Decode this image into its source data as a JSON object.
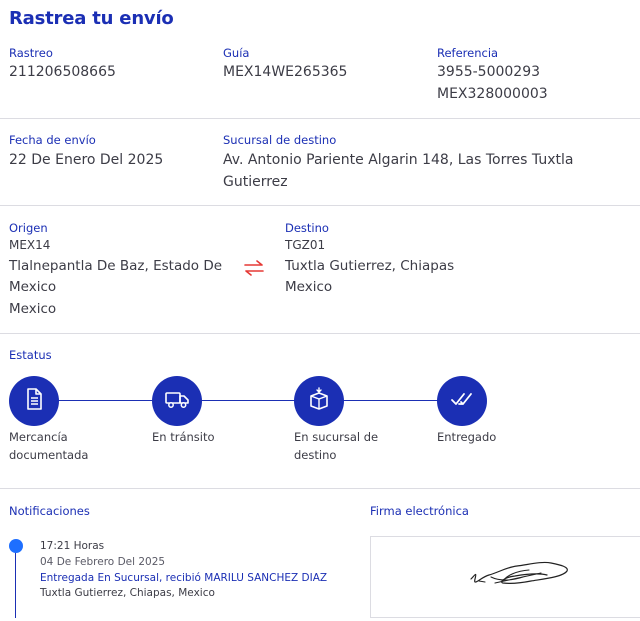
{
  "header": {
    "title": "Rastrea tu envío"
  },
  "info_row1": {
    "rastreo": {
      "label": "Rastreo",
      "value": "211206508665"
    },
    "guia": {
      "label": "Guía",
      "value": "MEX14WE265365"
    },
    "referencia": {
      "label": "Referencia",
      "value1": "3955-5000293",
      "value2": "MEX328000003"
    }
  },
  "info_row2": {
    "fecha": {
      "label": "Fecha de envío",
      "value": "22 De Enero Del 2025"
    },
    "sucursal": {
      "label": "Sucursal de destino",
      "value1": "Av. Antonio Pariente Algarin 148, Las Torres Tuxtla",
      "value2": "Gutierrez"
    }
  },
  "route": {
    "origen": {
      "label": "Origen",
      "code": "MEX14",
      "line1": "Tlalnepantla De Baz, Estado De",
      "line2": "Mexico",
      "line3": "Mexico"
    },
    "swap_icon": "swap-arrows-icon",
    "destino": {
      "label": "Destino",
      "code": "TGZ01",
      "line1": "Tuxtla Gutierrez, Chiapas",
      "line2": "Mexico"
    }
  },
  "status": {
    "label": "Estatus",
    "steps": [
      {
        "icon": "document-icon",
        "line1": "Mercancía",
        "line2": "documentada"
      },
      {
        "icon": "truck-icon",
        "line1": "En tránsito",
        "line2": ""
      },
      {
        "icon": "package-icon",
        "line1": "En sucursal de",
        "line2": "destino"
      },
      {
        "icon": "double-check-icon",
        "line1": "Entregado",
        "line2": ""
      }
    ]
  },
  "notifications": {
    "label": "Notificaciones",
    "items": [
      {
        "time": "17:21 Horas",
        "date": "04 De Febrero Del 2025",
        "status": "Entregada En Sucursal, recibió MARILU SANCHEZ DIAZ",
        "place": "Tuxtla Gutierrez, Chiapas, Mexico"
      }
    ]
  },
  "signature": {
    "label": "Firma electrónica"
  },
  "colors": {
    "accent": "#1b2fb4",
    "dot": "#1e6fff",
    "swap": "#e53935",
    "divider": "#dcdce2"
  }
}
